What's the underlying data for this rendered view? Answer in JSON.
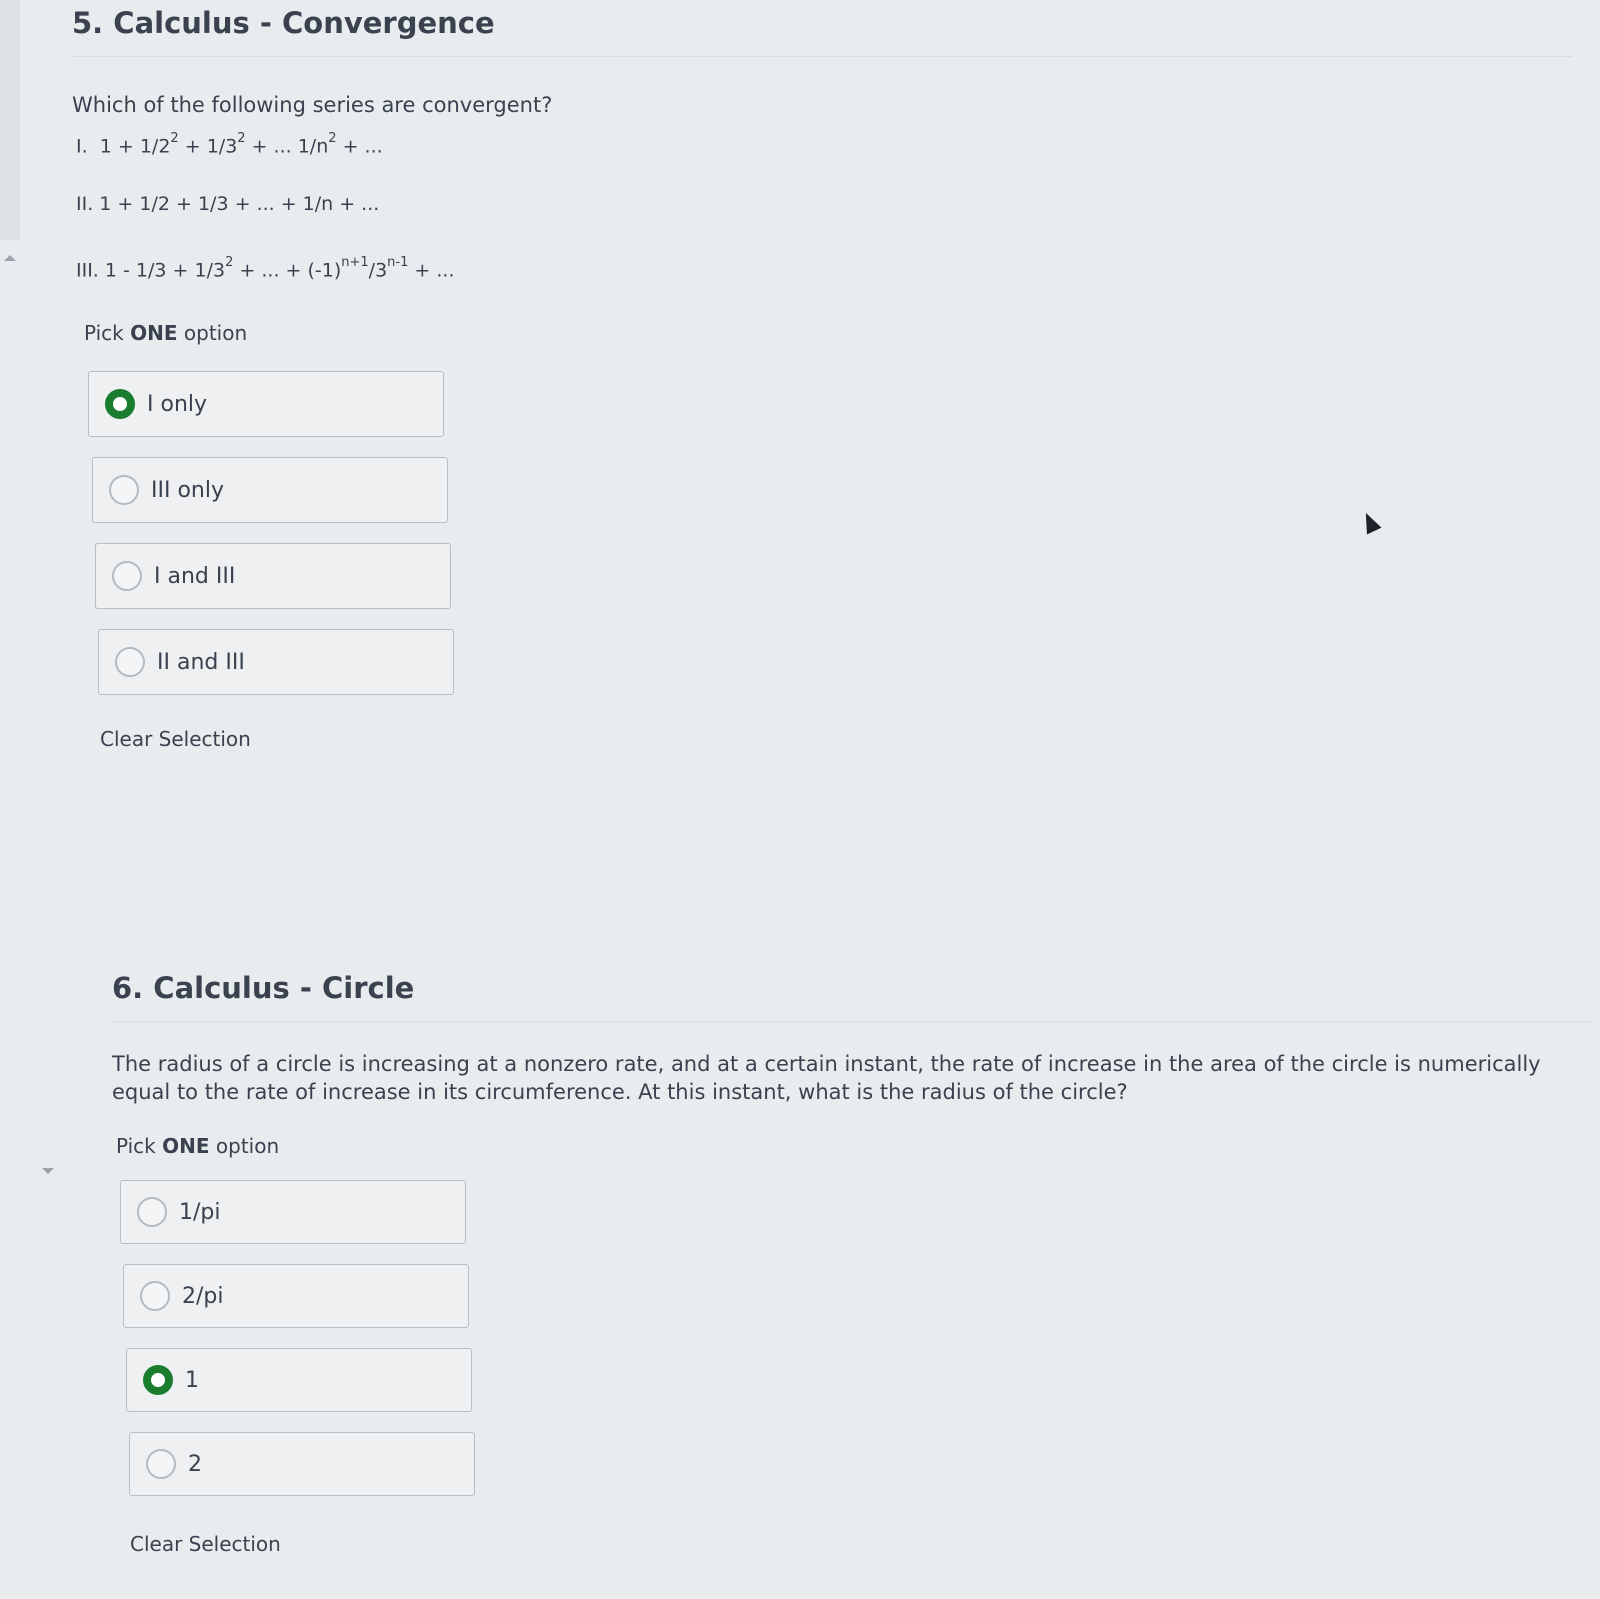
{
  "questions": [
    {
      "title": "5. Calculus - Convergence",
      "prompt": "Which of the following series are convergent?",
      "series": [
        {
          "numeral": "I.",
          "text_a": "1 + 1/2",
          "sup_a": "2",
          "text_b": " + 1/3",
          "sup_b": "2",
          "text_c": " + ... 1/n",
          "sup_c": "2",
          "text_d": " + ..."
        },
        {
          "numeral": "II.",
          "text": "1 + 1/2 + 1/3 + ... + 1/n + ..."
        },
        {
          "numeral": "III.",
          "text_a": "1 - 1/3 + 1/3",
          "sup_a": "2",
          "text_b": " + ... + (-1)",
          "sup_b": "n+1",
          "text_c": "/3",
          "sup_c": "n-1",
          "text_d": " + ..."
        }
      ],
      "pick_prefix": "Pick ",
      "pick_bold": "ONE",
      "pick_suffix": " option",
      "options": [
        {
          "label": "I only",
          "selected": true
        },
        {
          "label": "III only",
          "selected": false
        },
        {
          "label": "I and III",
          "selected": false
        },
        {
          "label": "II and III",
          "selected": false
        }
      ],
      "clear_label": "Clear Selection"
    },
    {
      "title": "6. Calculus - Circle",
      "prompt": "The radius of a circle is increasing at a nonzero rate, and at a certain instant, the rate of increase in the area of the circle is numerically equal to the rate of increase in its circumference. At this instant, what is the radius of the circle?",
      "pick_prefix": "Pick ",
      "pick_bold": "ONE",
      "pick_suffix": " option",
      "options": [
        {
          "label": "1/pi",
          "selected": false
        },
        {
          "label": "2/pi",
          "selected": false
        },
        {
          "label": "1",
          "selected": true
        },
        {
          "label": "2",
          "selected": false
        }
      ],
      "clear_label": "Clear Selection"
    }
  ],
  "colors": {
    "selected_radio": "#1a7d2e",
    "text": "#39424e",
    "background": "#e9ecef"
  },
  "icons": {
    "cursor": "mouse-pointer-icon",
    "radio_selected": "radio-checked-icon",
    "radio_unselected": "radio-unchecked-icon"
  }
}
